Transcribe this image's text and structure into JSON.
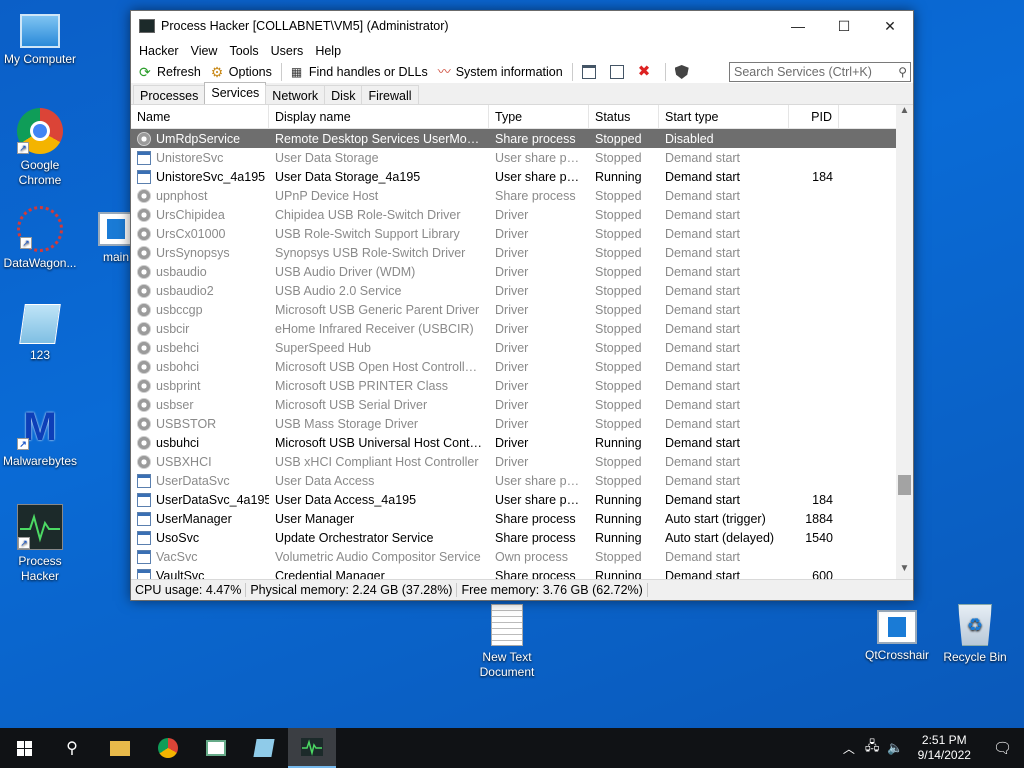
{
  "desktop": {
    "icons": [
      {
        "label": "My Computer"
      },
      {
        "label": "Google Chrome"
      },
      {
        "label": "DataWagon..."
      },
      {
        "label": "main"
      },
      {
        "label": "123"
      },
      {
        "label": "Malwarebytes"
      },
      {
        "label": "Process Hacker"
      },
      {
        "label": "New Text Document"
      },
      {
        "label": "QtCrosshair"
      },
      {
        "label": "Recycle Bin"
      }
    ]
  },
  "window": {
    "title": "Process Hacker [COLLABNET\\VM5] (Administrator)",
    "menu": [
      "Hacker",
      "View",
      "Tools",
      "Users",
      "Help"
    ],
    "toolbar": {
      "refresh": "Refresh",
      "options": "Options",
      "find_handles": "Find handles or DLLs",
      "system_info": "System information"
    },
    "search_placeholder": "Search Services (Ctrl+K)",
    "tabs": [
      "Processes",
      "Services",
      "Network",
      "Disk",
      "Firewall"
    ],
    "columns": [
      "Name",
      "Display name",
      "Type",
      "Status",
      "Start type",
      "PID"
    ],
    "rows": [
      {
        "name": "UmRdpService",
        "display": "Remote Desktop Services UserMode P...",
        "type": "Share process",
        "status": "Stopped",
        "start": "Disabled",
        "pid": "",
        "icon": "gear",
        "state": "selected"
      },
      {
        "name": "UnistoreSvc",
        "display": "User Data Storage",
        "type": "User share pro...",
        "status": "Stopped",
        "start": "Demand start",
        "pid": "",
        "icon": "win",
        "state": "stopped"
      },
      {
        "name": "UnistoreSvc_4a195",
        "display": "User Data Storage_4a195",
        "type": "User share pro...",
        "status": "Running",
        "start": "Demand start",
        "pid": "184",
        "icon": "win",
        "state": "running"
      },
      {
        "name": "upnphost",
        "display": "UPnP Device Host",
        "type": "Share process",
        "status": "Stopped",
        "start": "Demand start",
        "pid": "",
        "icon": "gear",
        "state": "stopped"
      },
      {
        "name": "UrsChipidea",
        "display": "Chipidea USB Role-Switch Driver",
        "type": "Driver",
        "status": "Stopped",
        "start": "Demand start",
        "pid": "",
        "icon": "gear",
        "state": "stopped"
      },
      {
        "name": "UrsCx01000",
        "display": "USB Role-Switch Support Library",
        "type": "Driver",
        "status": "Stopped",
        "start": "Demand start",
        "pid": "",
        "icon": "gear",
        "state": "stopped"
      },
      {
        "name": "UrsSynopsys",
        "display": "Synopsys USB Role-Switch Driver",
        "type": "Driver",
        "status": "Stopped",
        "start": "Demand start",
        "pid": "",
        "icon": "gear",
        "state": "stopped"
      },
      {
        "name": "usbaudio",
        "display": "USB Audio Driver (WDM)",
        "type": "Driver",
        "status": "Stopped",
        "start": "Demand start",
        "pid": "",
        "icon": "gear",
        "state": "stopped"
      },
      {
        "name": "usbaudio2",
        "display": "USB Audio 2.0 Service",
        "type": "Driver",
        "status": "Stopped",
        "start": "Demand start",
        "pid": "",
        "icon": "gear",
        "state": "stopped"
      },
      {
        "name": "usbccgp",
        "display": "Microsoft USB Generic Parent Driver",
        "type": "Driver",
        "status": "Stopped",
        "start": "Demand start",
        "pid": "",
        "icon": "gear",
        "state": "stopped"
      },
      {
        "name": "usbcir",
        "display": "eHome Infrared Receiver (USBCIR)",
        "type": "Driver",
        "status": "Stopped",
        "start": "Demand start",
        "pid": "",
        "icon": "gear",
        "state": "stopped"
      },
      {
        "name": "usbehci",
        "display": "SuperSpeed Hub",
        "type": "Driver",
        "status": "Stopped",
        "start": "Demand start",
        "pid": "",
        "icon": "gear",
        "state": "stopped"
      },
      {
        "name": "usbohci",
        "display": "Microsoft USB Open Host Controller ...",
        "type": "Driver",
        "status": "Stopped",
        "start": "Demand start",
        "pid": "",
        "icon": "gear",
        "state": "stopped"
      },
      {
        "name": "usbprint",
        "display": "Microsoft USB PRINTER Class",
        "type": "Driver",
        "status": "Stopped",
        "start": "Demand start",
        "pid": "",
        "icon": "gear",
        "state": "stopped"
      },
      {
        "name": "usbser",
        "display": "Microsoft USB Serial Driver",
        "type": "Driver",
        "status": "Stopped",
        "start": "Demand start",
        "pid": "",
        "icon": "gear",
        "state": "stopped"
      },
      {
        "name": "USBSTOR",
        "display": "USB Mass Storage Driver",
        "type": "Driver",
        "status": "Stopped",
        "start": "Demand start",
        "pid": "",
        "icon": "gear",
        "state": "stopped"
      },
      {
        "name": "usbuhci",
        "display": "Microsoft USB Universal Host Control...",
        "type": "Driver",
        "status": "Running",
        "start": "Demand start",
        "pid": "",
        "icon": "gear",
        "state": "running"
      },
      {
        "name": "USBXHCI",
        "display": "USB xHCI Compliant Host Controller",
        "type": "Driver",
        "status": "Stopped",
        "start": "Demand start",
        "pid": "",
        "icon": "gear",
        "state": "stopped"
      },
      {
        "name": "UserDataSvc",
        "display": "User Data Access",
        "type": "User share pro...",
        "status": "Stopped",
        "start": "Demand start",
        "pid": "",
        "icon": "win",
        "state": "stopped"
      },
      {
        "name": "UserDataSvc_4a195",
        "display": "User Data Access_4a195",
        "type": "User share pro...",
        "status": "Running",
        "start": "Demand start",
        "pid": "184",
        "icon": "win",
        "state": "running"
      },
      {
        "name": "UserManager",
        "display": "User Manager",
        "type": "Share process",
        "status": "Running",
        "start": "Auto start (trigger)",
        "pid": "1884",
        "icon": "win",
        "state": "running"
      },
      {
        "name": "UsoSvc",
        "display": "Update Orchestrator Service",
        "type": "Share process",
        "status": "Running",
        "start": "Auto start (delayed)",
        "pid": "1540",
        "icon": "win",
        "state": "running"
      },
      {
        "name": "VacSvc",
        "display": "Volumetric Audio Compositor Service",
        "type": "Own process",
        "status": "Stopped",
        "start": "Demand start",
        "pid": "",
        "icon": "win",
        "state": "stopped"
      },
      {
        "name": "VaultSvc",
        "display": "Credential Manager",
        "type": "Share process",
        "status": "Running",
        "start": "Demand start",
        "pid": "600",
        "icon": "win",
        "state": "running"
      }
    ],
    "status": {
      "cpu": "CPU usage: 4.47%",
      "physical": "Physical memory: 2.24 GB (37.28%)",
      "free": "Free memory: 3.76 GB (62.72%)"
    }
  },
  "taskbar": {
    "time": "2:51 PM",
    "date": "9/14/2022"
  }
}
